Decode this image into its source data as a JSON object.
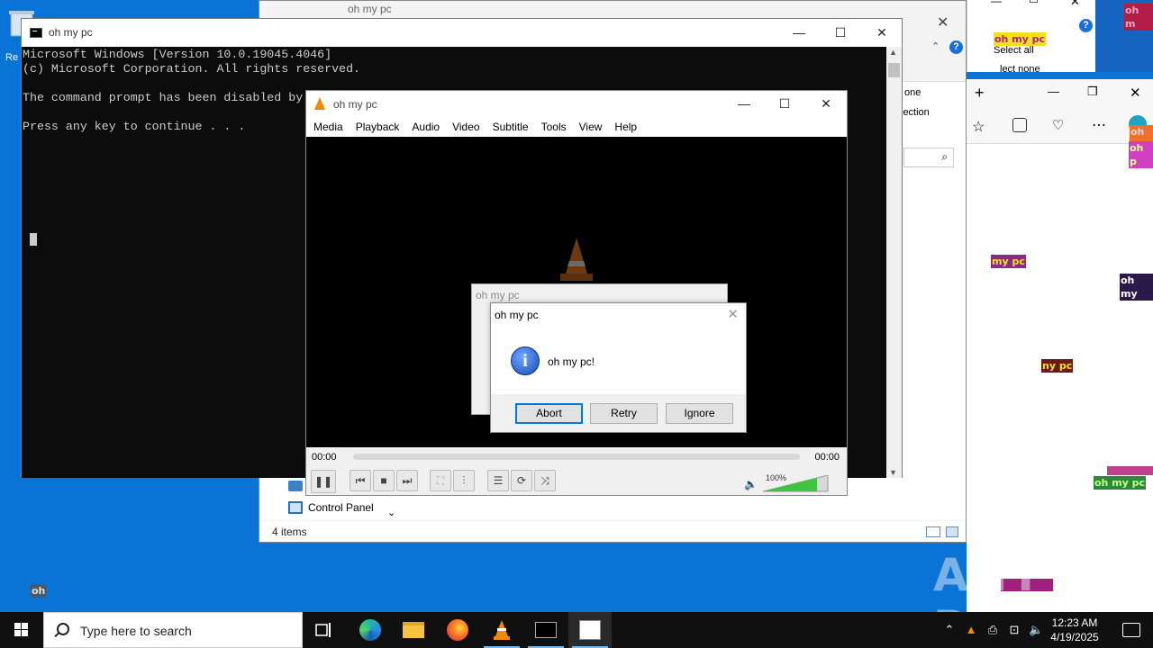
{
  "cmd": {
    "title": "oh my pc",
    "lines": [
      "Microsoft Windows [Version 10.0.19045.4046]",
      "(c) Microsoft Corporation. All rights reserved.",
      "",
      "The command prompt has been disabled by your administrator.",
      "",
      "Press any key to continue . . ."
    ]
  },
  "vlc": {
    "title": "oh my pc",
    "menu": [
      "Media",
      "Playback",
      "Audio",
      "Video",
      "Subtitle",
      "Tools",
      "View",
      "Help"
    ],
    "time_elapsed": "00:00",
    "time_total": "00:00",
    "volume": "100%",
    "volume_level": 1.0
  },
  "dialog_back": {
    "title": "oh my pc"
  },
  "dialog": {
    "title": "oh my pc",
    "message": "oh my pc!",
    "buttons": {
      "abort": "Abort",
      "retry": "Retry",
      "ignore": "Ignore"
    }
  },
  "explorer": {
    "nav_item": "Control Panel",
    "status": "4 items",
    "ribbon_right": [
      "one",
      "lection"
    ],
    "top_title": "oh my pc"
  },
  "top_right_panel": {
    "select_all": "Select all",
    "select_none": "lect none"
  },
  "tags": [
    {
      "text": "oh my pc",
      "bg": "#f3e11c",
      "fg": "#b21e8a"
    },
    {
      "text": "oh m",
      "bg": "#b21e48",
      "fg": "#e8a5c0"
    },
    {
      "text": "oh r",
      "bg": "#f07028",
      "fg": "#d8d8d8"
    },
    {
      "text": "oh p",
      "bg": "#d040c0",
      "fg": "#ff9"
    },
    {
      "text": "my pc",
      "bg": "#8a2a8a",
      "fg": "#f3e11c"
    },
    {
      "text": "oh my",
      "bg": "#2a1a4a",
      "fg": "#ffffff"
    },
    {
      "text": "ny pc",
      "bg": "#6a1a1a",
      "fg": "#f3e11c"
    },
    {
      "text": "oh my pc",
      "bg": "#2a8a3a",
      "fg": "#c0ff90"
    },
    {
      "text": "oh",
      "bg": "#4a5a6a",
      "fg": "#dddddd"
    }
  ],
  "taskbar": {
    "search_placeholder": "Type here to search",
    "time": "12:23 AM",
    "date": "4/19/2025"
  },
  "watermark": "ANY RUN"
}
